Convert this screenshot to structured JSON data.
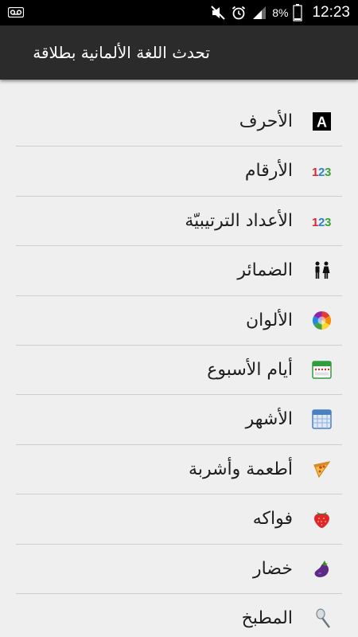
{
  "status_bar": {
    "battery_percent": "8%",
    "time": "12:23"
  },
  "action_bar": {
    "title": "تحدث اللغة الألمانية بطلاقة"
  },
  "menu": {
    "items": [
      {
        "label": "الأحرف",
        "icon": "letter-a-icon"
      },
      {
        "label": "الأرقام",
        "icon": "numbers-123-icon"
      },
      {
        "label": "الأعداد الترتيبيّة",
        "icon": "ordinal-numbers-icon"
      },
      {
        "label": "الضمائر",
        "icon": "people-icon"
      },
      {
        "label": "الألوان",
        "icon": "color-wheel-icon"
      },
      {
        "label": "أيام الأسبوع",
        "icon": "calendar-week-icon"
      },
      {
        "label": "الأشهر",
        "icon": "calendar-month-icon"
      },
      {
        "label": "أطعمة وأشربة",
        "icon": "pizza-icon"
      },
      {
        "label": "فواكه",
        "icon": "strawberry-icon"
      },
      {
        "label": "خضار",
        "icon": "eggplant-icon"
      },
      {
        "label": "المطبخ",
        "icon": "kitchen-icon"
      }
    ]
  },
  "colors": {
    "status_bar_bg": "#000000",
    "action_bar_bg": "#2b2b2b",
    "list_bg": "#efefef",
    "divider": "#cdcdcd",
    "text": "#1e1e1e"
  }
}
